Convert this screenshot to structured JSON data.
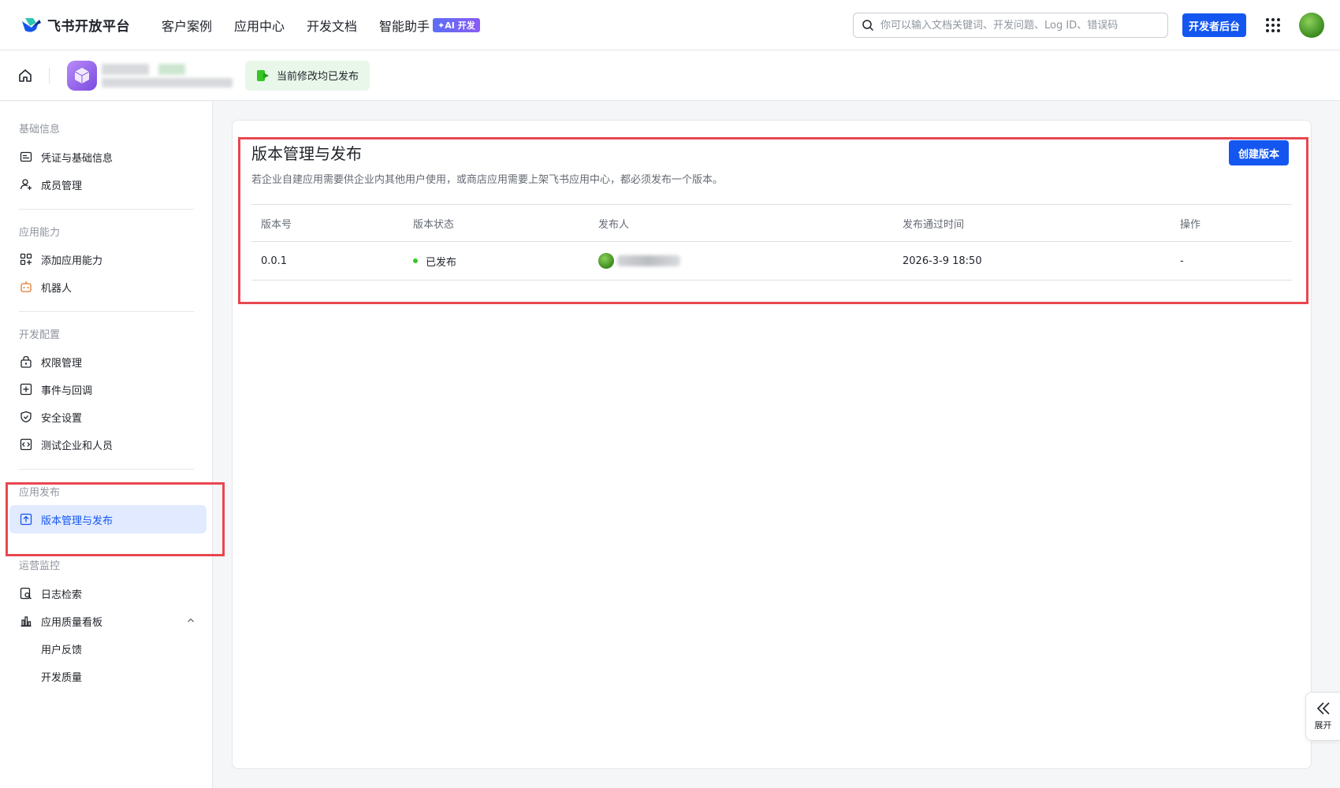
{
  "brand": {
    "name": "飞书开放平台"
  },
  "nav": {
    "items": [
      "客户案例",
      "应用中心",
      "开发文档",
      "智能助手"
    ],
    "ai_badge": "✦AI 开发"
  },
  "search": {
    "placeholder": "你可以输入文档关键词、开发问题、Log ID、错误码"
  },
  "header": {
    "developer_console": "开发者后台"
  },
  "subbar": {
    "status": "当前修改均已发布"
  },
  "sidebar": {
    "sections": [
      {
        "title": "基础信息",
        "items": [
          {
            "label": "凭证与基础信息",
            "icon": "credential-icon"
          },
          {
            "label": "成员管理",
            "icon": "member-add-icon"
          }
        ]
      },
      {
        "title": "应用能力",
        "items": [
          {
            "label": "添加应用能力",
            "icon": "grid-add-icon"
          },
          {
            "label": "机器人",
            "icon": "robot-icon"
          }
        ]
      },
      {
        "title": "开发配置",
        "items": [
          {
            "label": "权限管理",
            "icon": "lock-icon"
          },
          {
            "label": "事件与回调",
            "icon": "event-icon"
          },
          {
            "label": "安全设置",
            "icon": "shield-icon"
          },
          {
            "label": "测试企业和人员",
            "icon": "code-box-icon"
          }
        ]
      },
      {
        "title": "应用发布",
        "items": [
          {
            "label": "版本管理与发布",
            "icon": "upload-box-icon",
            "active": true
          }
        ]
      },
      {
        "title": "运营监控",
        "items": [
          {
            "label": "日志检索",
            "icon": "log-search-icon"
          },
          {
            "label": "应用质量看板",
            "icon": "bar-chart-icon"
          },
          {
            "label": "用户反馈"
          },
          {
            "label": "开发质量"
          }
        ]
      }
    ]
  },
  "main": {
    "title": "版本管理与发布",
    "description": "若企业自建应用需要供企业内其他用户使用，或商店应用需要上架飞书应用中心，都必须发布一个版本。",
    "create_button": "创建版本",
    "table": {
      "headers": [
        "版本号",
        "版本状态",
        "发布人",
        "发布通过时间",
        "操作"
      ],
      "rows": [
        {
          "version": "0.0.1",
          "status": "已发布",
          "time": "2026-3-9 18:50",
          "action": "-"
        }
      ]
    }
  },
  "expand_tab": {
    "label": "展开"
  },
  "colors": {
    "accent": "#1456f0",
    "active_bg": "#e1eaff",
    "highlight": "#e8474f",
    "published_dot": "#34c724"
  }
}
